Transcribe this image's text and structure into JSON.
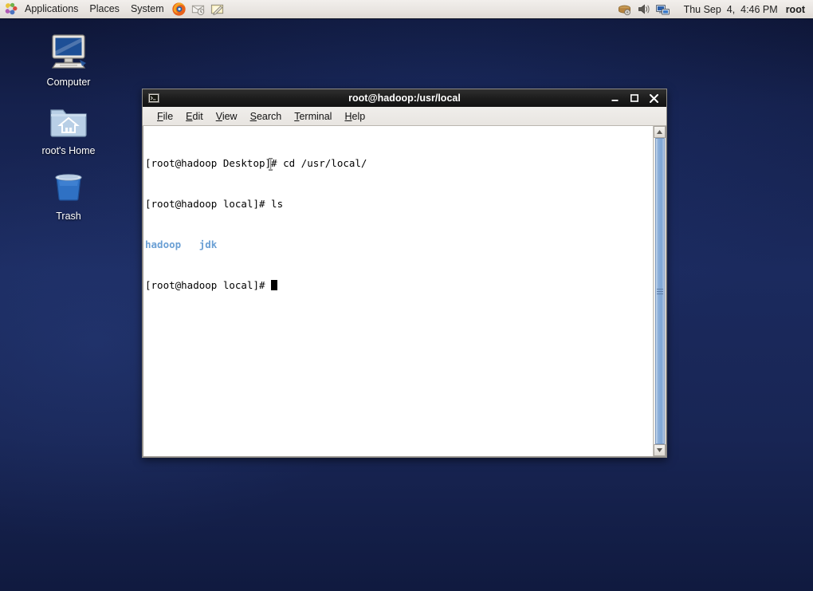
{
  "panel": {
    "logo_icon": "gnome-foot-icon",
    "menus": [
      {
        "label": "Applications",
        "name": "applications-menu"
      },
      {
        "label": "Places",
        "name": "places-menu"
      },
      {
        "label": "System",
        "name": "system-menu"
      }
    ],
    "launchers": [
      {
        "name": "firefox-launcher-icon",
        "title": "Firefox Web Browser"
      },
      {
        "name": "evolution-mail-launcher-icon",
        "title": "Evolution Mail"
      },
      {
        "name": "text-editor-launcher-icon",
        "title": "Text Editor"
      }
    ],
    "tray": [
      {
        "name": "update-manager-icon"
      },
      {
        "name": "volume-speaker-icon"
      },
      {
        "name": "network-monitor-icon"
      }
    ],
    "clock": "Thu Sep  4,  4:46 PM",
    "user": "root"
  },
  "desktop": {
    "icons": [
      {
        "label": "Computer",
        "name": "desktop-icon-computer",
        "icon": "computer-monitor-icon"
      },
      {
        "label": "root's Home",
        "name": "desktop-icon-home",
        "icon": "home-folder-icon"
      },
      {
        "label": "Trash",
        "name": "desktop-icon-trash",
        "icon": "trash-bin-icon"
      }
    ]
  },
  "terminal": {
    "title": "root@hadoop:/usr/local",
    "title_icon": "terminal-icon",
    "window_buttons": {
      "minimize": "minimize-icon",
      "maximize": "maximize-icon",
      "close": "close-icon"
    },
    "menus": [
      {
        "label": "File",
        "mnemonic": "F",
        "name": "menu-file"
      },
      {
        "label": "Edit",
        "mnemonic": "E",
        "name": "menu-edit"
      },
      {
        "label": "View",
        "mnemonic": "V",
        "name": "menu-view"
      },
      {
        "label": "Search",
        "mnemonic": "S",
        "name": "menu-search"
      },
      {
        "label": "Terminal",
        "mnemonic": "T",
        "name": "menu-terminal"
      },
      {
        "label": "Help",
        "mnemonic": "H",
        "name": "menu-help"
      }
    ],
    "lines": [
      {
        "type": "prompt_cmd",
        "prompt": "[root@hadoop Desktop]# ",
        "command": "cd /usr/local/"
      },
      {
        "type": "prompt_cmd",
        "prompt": "[root@hadoop local]# ",
        "command": "ls"
      },
      {
        "type": "output_dirs",
        "items": [
          "hadoop",
          "jdk"
        ],
        "color": "#6a9fd4"
      },
      {
        "type": "prompt_cursor",
        "prompt": "[root@hadoop local]# "
      }
    ],
    "scrollbar": {
      "up_arrow": "scroll-up-arrow-icon",
      "down_arrow": "scroll-down-arrow-icon",
      "thumb": "scrollbar-thumb"
    }
  },
  "colors": {
    "desktop_bg": "#1b2a5e",
    "panel_bg": "#e9e5e1",
    "titlebar_bg": "#1d1d1d",
    "terminal_bg": "#ffffff",
    "terminal_fg": "#000000",
    "dir_color": "#6a9fd4",
    "scrollbar_accent": "#8cb0da"
  }
}
